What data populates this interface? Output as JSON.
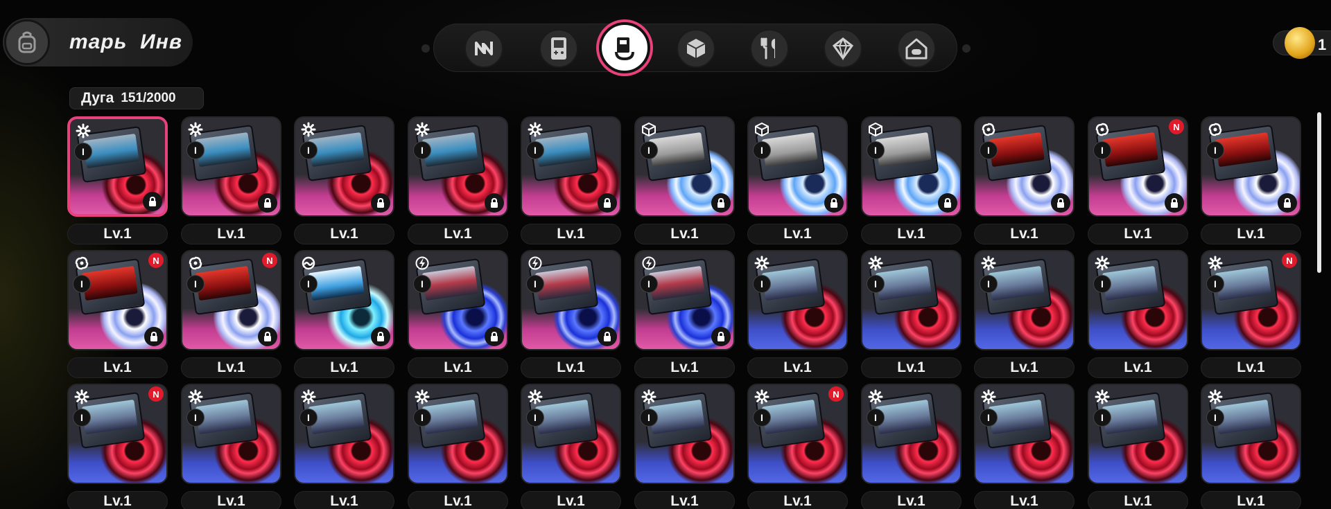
{
  "header": {
    "title": "тарь  Инв",
    "bag_icon": "backpack-icon"
  },
  "tabs": [
    {
      "icon": "n-logo-icon",
      "active": false
    },
    {
      "icon": "handheld-console-icon",
      "active": false
    },
    {
      "icon": "drive-disc-icon",
      "active": true
    },
    {
      "icon": "cube-icon",
      "active": false
    },
    {
      "icon": "cutlery-icon",
      "active": false
    },
    {
      "icon": "crystal-icon",
      "active": false
    },
    {
      "icon": "house-gamepad-icon",
      "active": false
    }
  ],
  "currency": {
    "value": "1",
    "icon": "gold-egg-coin-icon"
  },
  "capacity": {
    "label": "Дуга",
    "value": "151/2000"
  },
  "colors": {
    "accent_pink": "#e8417c",
    "rarity_s_bottom": "#e15aa8",
    "rarity_a_bottom": "#5367e6",
    "new_badge": "#e01b2c"
  },
  "items": [
    {
      "level": "Lv.1",
      "rarity": "pink",
      "type_icon": "gear-icon",
      "art": "rain",
      "disc": "red",
      "rank": "I",
      "locked": true,
      "new": false,
      "selected": true
    },
    {
      "level": "Lv.1",
      "rarity": "pink",
      "type_icon": "gear-icon",
      "art": "rain",
      "disc": "red",
      "rank": "I",
      "locked": true,
      "new": false
    },
    {
      "level": "Lv.1",
      "rarity": "pink",
      "type_icon": "gear-icon",
      "art": "rain",
      "disc": "red",
      "rank": "I",
      "locked": true,
      "new": false
    },
    {
      "level": "Lv.1",
      "rarity": "pink",
      "type_icon": "gear-icon",
      "art": "rain",
      "disc": "red",
      "rank": "I",
      "locked": true,
      "new": false
    },
    {
      "level": "Lv.1",
      "rarity": "pink",
      "type_icon": "gear-icon",
      "art": "rain",
      "disc": "red",
      "rank": "I",
      "locked": true,
      "new": false
    },
    {
      "level": "Lv.1",
      "rarity": "pink",
      "type_icon": "ice-cube-icon",
      "art": "fossil",
      "disc": "ice",
      "rank": "I",
      "locked": true,
      "new": false
    },
    {
      "level": "Lv.1",
      "rarity": "pink",
      "type_icon": "ice-cube-icon",
      "art": "fossil",
      "disc": "ice",
      "rank": "I",
      "locked": true,
      "new": false
    },
    {
      "level": "Lv.1",
      "rarity": "pink",
      "type_icon": "ice-cube-icon",
      "art": "fossil",
      "disc": "ice",
      "rank": "I",
      "locked": true,
      "new": false
    },
    {
      "level": "Lv.1",
      "rarity": "pink",
      "type_icon": "swirl-icon",
      "art": "red",
      "disc": "swirl",
      "rank": "I",
      "locked": true,
      "new": false
    },
    {
      "level": "Lv.1",
      "rarity": "pink",
      "type_icon": "swirl-icon",
      "art": "red",
      "disc": "swirl",
      "rank": "I",
      "locked": true,
      "new": true
    },
    {
      "level": "Lv.1",
      "rarity": "pink",
      "type_icon": "swirl-icon",
      "art": "red",
      "disc": "swirl",
      "rank": "I",
      "locked": true,
      "new": false
    },
    {
      "level": "Lv.1",
      "rarity": "pink",
      "type_icon": "swirl-icon",
      "art": "red",
      "disc": "swirl",
      "rank": "I",
      "locked": true,
      "new": true
    },
    {
      "level": "Lv.1",
      "rarity": "pink",
      "type_icon": "swirl-icon",
      "art": "red",
      "disc": "swirl",
      "rank": "I",
      "locked": true,
      "new": true
    },
    {
      "level": "Lv.1",
      "rarity": "pink",
      "type_icon": "wave-icon",
      "art": "cyan",
      "disc": "cyan",
      "rank": "I",
      "locked": true,
      "new": false
    },
    {
      "level": "Lv.1",
      "rarity": "pink",
      "type_icon": "lightning-icon",
      "art": "elec",
      "disc": "electric",
      "rank": "I",
      "locked": true,
      "new": false
    },
    {
      "level": "Lv.1",
      "rarity": "pink",
      "type_icon": "lightning-icon",
      "art": "elec",
      "disc": "electric",
      "rank": "I",
      "locked": true,
      "new": false
    },
    {
      "level": "Lv.1",
      "rarity": "pink",
      "type_icon": "lightning-icon",
      "art": "elec",
      "disc": "electric",
      "rank": "I",
      "locked": true,
      "new": false
    },
    {
      "level": "Lv.1",
      "rarity": "blue",
      "type_icon": "gear-icon",
      "art": "cosmo",
      "disc": "red",
      "rank": "I",
      "locked": false,
      "new": false
    },
    {
      "level": "Lv.1",
      "rarity": "blue",
      "type_icon": "gear-icon",
      "art": "cosmo",
      "disc": "red",
      "rank": "I",
      "locked": false,
      "new": false
    },
    {
      "level": "Lv.1",
      "rarity": "blue",
      "type_icon": "gear-icon",
      "art": "cosmo",
      "disc": "red",
      "rank": "I",
      "locked": false,
      "new": false
    },
    {
      "level": "Lv.1",
      "rarity": "blue",
      "type_icon": "gear-icon",
      "art": "cosmo",
      "disc": "red",
      "rank": "I",
      "locked": false,
      "new": false
    },
    {
      "level": "Lv.1",
      "rarity": "blue",
      "type_icon": "gear-icon",
      "art": "cosmo",
      "disc": "red",
      "rank": "I",
      "locked": false,
      "new": true
    },
    {
      "level": "Lv.1",
      "rarity": "blue",
      "type_icon": "gear-icon",
      "art": "cosmo",
      "disc": "red",
      "rank": "I",
      "locked": false,
      "new": true
    },
    {
      "level": "Lv.1",
      "rarity": "blue",
      "type_icon": "gear-icon",
      "art": "cosmo",
      "disc": "red",
      "rank": "I",
      "locked": false,
      "new": false
    },
    {
      "level": "Lv.1",
      "rarity": "blue",
      "type_icon": "gear-icon",
      "art": "cosmo",
      "disc": "red",
      "rank": "I",
      "locked": false,
      "new": false
    },
    {
      "level": "Lv.1",
      "rarity": "blue",
      "type_icon": "gear-icon",
      "art": "cosmo",
      "disc": "red",
      "rank": "I",
      "locked": false,
      "new": false
    },
    {
      "level": "Lv.1",
      "rarity": "blue",
      "type_icon": "gear-icon",
      "art": "cosmo",
      "disc": "red",
      "rank": "I",
      "locked": false,
      "new": false
    },
    {
      "level": "Lv.1",
      "rarity": "blue",
      "type_icon": "gear-icon",
      "art": "cosmo",
      "disc": "red",
      "rank": "I",
      "locked": false,
      "new": false
    },
    {
      "level": "Lv.1",
      "rarity": "blue",
      "type_icon": "gear-icon",
      "art": "cosmo",
      "disc": "red",
      "rank": "I",
      "locked": false,
      "new": true
    },
    {
      "level": "Lv.1",
      "rarity": "blue",
      "type_icon": "gear-icon",
      "art": "cosmo",
      "disc": "red",
      "rank": "I",
      "locked": false,
      "new": false
    },
    {
      "level": "Lv.1",
      "rarity": "blue",
      "type_icon": "gear-icon",
      "art": "cosmo",
      "disc": "red",
      "rank": "I",
      "locked": false,
      "new": false
    },
    {
      "level": "Lv.1",
      "rarity": "blue",
      "type_icon": "gear-icon",
      "art": "cosmo",
      "disc": "red",
      "rank": "I",
      "locked": false,
      "new": false
    },
    {
      "level": "Lv.1",
      "rarity": "blue",
      "type_icon": "gear-icon",
      "art": "cosmo",
      "disc": "red",
      "rank": "I",
      "locked": false,
      "new": false
    }
  ],
  "new_badge_text": "N"
}
